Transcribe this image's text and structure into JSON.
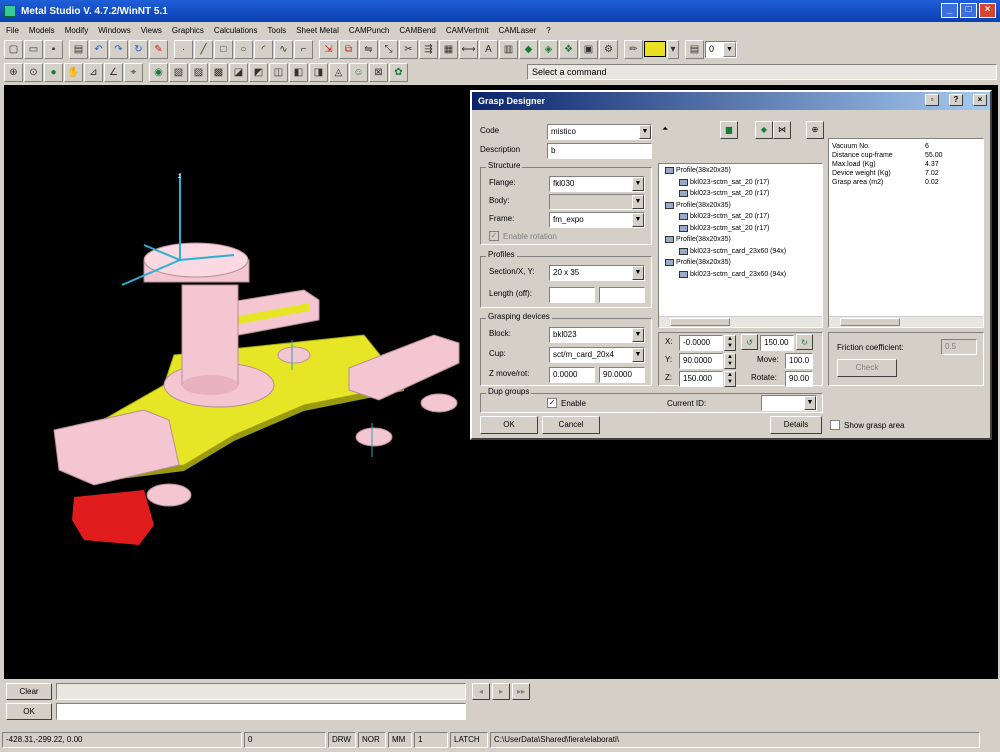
{
  "window": {
    "title": "Metal Studio V. 4.7.2/WinNT 5.1"
  },
  "menu": [
    "File",
    "Models",
    "Modify",
    "Windows",
    "Views",
    "Graphics",
    "Calculations",
    "Tools",
    "Sheet Metal",
    "CAMPunch",
    "CAMBend",
    "CAMVertmit",
    "CAMLaser",
    "?"
  ],
  "toolbar": {
    "layer_value": "0",
    "status_text": "Select a command"
  },
  "dialog": {
    "title": "Grasp Designer",
    "code_label": "Code",
    "code_value": "mistico",
    "description_label": "Description",
    "description_value": "b",
    "structure": {
      "title": "Structure",
      "flange_label": "Flange:",
      "flange_value": "fkl030",
      "body_label": "Body:",
      "body_value": "",
      "frame_label": "Frame:",
      "frame_value": "fm_expo",
      "enable_rotation_label": "Enable rotation"
    },
    "profiles": {
      "title": "Profiles",
      "section_label": "Section/X, Y:",
      "section_value": "20 x 35",
      "length_label": "Length (off):",
      "length_value_1": "",
      "length_value_2": ""
    },
    "grasping": {
      "title": "Grasping devices",
      "block_label": "Block:",
      "block_value": "bkl023",
      "cup_label": "Cup:",
      "cup_value": "sct/m_card_20x4",
      "z_label": "Z move/rot:",
      "z_value_1": "0.0000",
      "z_value_2": "90.0000"
    },
    "coords": {
      "x_label": "X:",
      "x_value": "-0.0000",
      "y_label": "Y:",
      "y_value": "90.0000",
      "z_label": "Z:",
      "z_value": "150.000",
      "angle_value": "150.00",
      "move_label": "Move:",
      "move_value": "100.0",
      "rotate_label": "Rotate:",
      "rotate_value": "90.00"
    },
    "friction": {
      "label": "Friction coefficient:",
      "value": "0.5",
      "check_label": "Check"
    },
    "dup": {
      "title": "Dup groups",
      "enable_label": "Enable",
      "current_id_label": "Current ID:",
      "current_id_value": ""
    },
    "tree": [
      {
        "text": "Profile(38x20x35)",
        "indent": 0
      },
      {
        "text": "bkl023-sctm_sat_20 (r17)",
        "indent": 1
      },
      {
        "text": "bkl023-sctm_sat_20 (r17)",
        "indent": 1
      },
      {
        "text": "Profile(38x20x35)",
        "indent": 0
      },
      {
        "text": "bkl023-sctm_sat_20 (r17)",
        "indent": 1
      },
      {
        "text": "bkl023-sctm_sat_20 (r17)",
        "indent": 1
      },
      {
        "text": "Profile(38x20x35)",
        "indent": 0
      },
      {
        "text": "bkl023-sctm_card_23x60 (94x)",
        "indent": 1
      },
      {
        "text": "Profile(38x20x35)",
        "indent": 0
      },
      {
        "text": "bkl023-sctm_card_23x60 (94x)",
        "indent": 1
      }
    ],
    "properties": [
      {
        "name": "Vacuum No.",
        "value": "6"
      },
      {
        "name": "Distance cup-frame",
        "value": "55.00"
      },
      {
        "name": "Max.load (Kg)",
        "value": "4.37"
      },
      {
        "name": "Device weight (Kg)",
        "value": "7.02"
      },
      {
        "name": "Grasp area (m2)",
        "value": "0.02"
      }
    ],
    "ok_label": "OK",
    "cancel_label": "Cancel",
    "details_label": "Details",
    "show_grasp_area_label": "Show grasp area"
  },
  "command": {
    "clear_label": "Clear",
    "ok_label": "OK"
  },
  "statusbar": {
    "coords": "-428.31,-299.22, 0.00",
    "layer": "0",
    "drw": "DRW",
    "nor": "NOR",
    "units": "MM",
    "count": "1",
    "latch": "LATCH",
    "path": "C:\\UserData\\Shared\\fiera\\elaborati\\"
  },
  "colors": {
    "viewport_bg": "#000000",
    "yellow": "#e6e626",
    "pink": "#f4c6d2",
    "red": "#e01c1c",
    "accent": "#0a246a"
  }
}
